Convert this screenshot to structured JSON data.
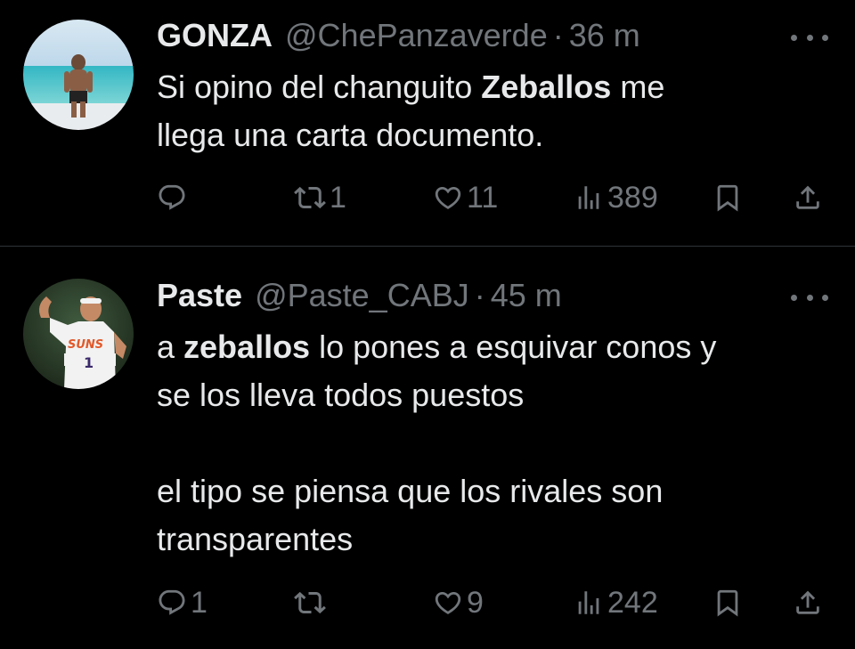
{
  "tweets": [
    {
      "display_name": "GONZA",
      "handle": "@ChePanzaverde",
      "separator": "·",
      "time": "36 m",
      "text_lines": [
        [
          {
            "t": "Si opino del changuito "
          },
          {
            "t": "Zeballos",
            "b": true
          },
          {
            "t": " me"
          }
        ],
        [
          {
            "t": "llega una carta documento."
          }
        ]
      ],
      "replies": "",
      "retweets": "1",
      "likes": "11",
      "views": "389"
    },
    {
      "display_name": "Paste",
      "handle": "@Paste_CABJ",
      "separator": "·",
      "time": "45 m",
      "text_lines": [
        [
          {
            "t": "a "
          },
          {
            "t": "zeballos",
            "b": true
          },
          {
            "t": " lo pones a esquivar conos y"
          }
        ],
        [
          {
            "t": "se los lleva todos puestos"
          }
        ],
        [
          {
            "t": ""
          }
        ],
        [
          {
            "t": "el tipo se piensa que los rivales son"
          }
        ],
        [
          {
            "t": "transparentes"
          }
        ]
      ],
      "replies": "1",
      "retweets": "",
      "likes": "9",
      "views": "242"
    }
  ],
  "icons": {
    "reply": "reply-icon",
    "retweet": "retweet-icon",
    "like": "heart-icon",
    "views": "views-icon",
    "bookmark": "bookmark-icon",
    "share": "share-icon",
    "more": "more-icon"
  },
  "colors": {
    "background": "#000000",
    "primary_text": "#e7e9ea",
    "secondary_text": "#71767b",
    "divider": "#2f3336"
  }
}
